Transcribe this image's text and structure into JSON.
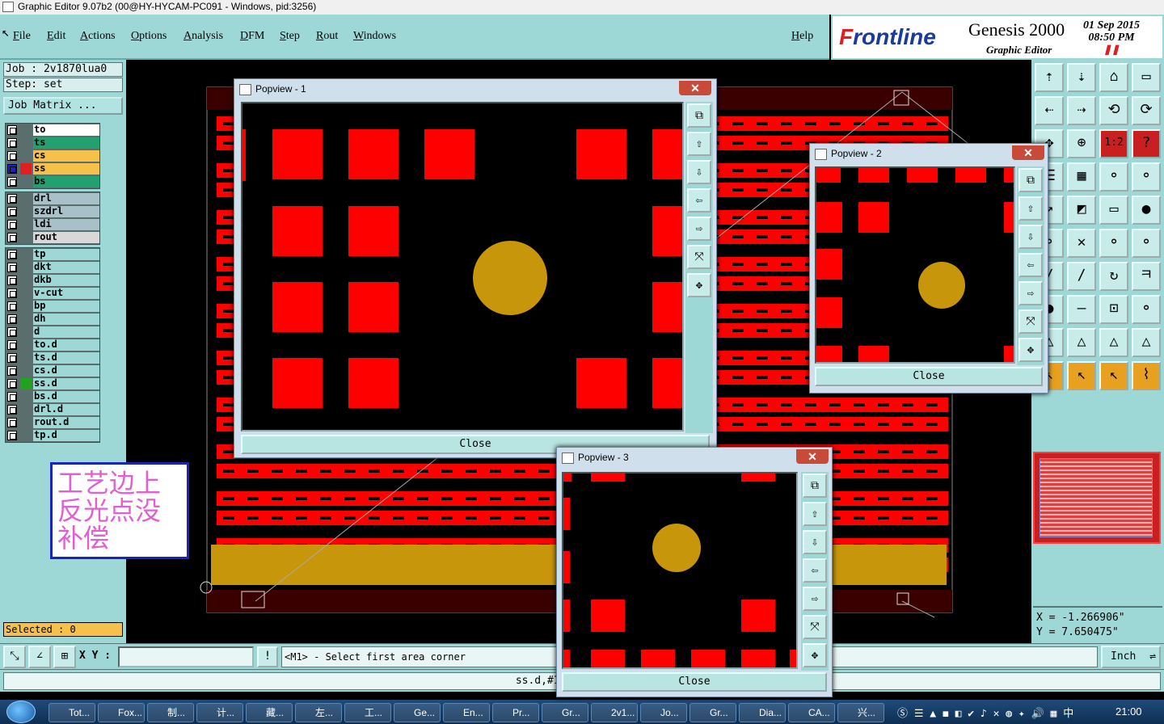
{
  "window": {
    "title": "Graphic Editor 9.07b2 (00@HY-HYCAM-PC091 - Windows, pid:3256)"
  },
  "menu": {
    "items": [
      "File",
      "Edit",
      "Actions",
      "Options",
      "Analysis",
      "DFM",
      "Step",
      "Rout",
      "Windows"
    ],
    "help": "Help"
  },
  "brand": {
    "logo_f": "F",
    "logo_rest": "rontline",
    "product": "Genesis 2000",
    "subtitle": "Graphic Editor",
    "date": "01 Sep 2015",
    "time": "08:50 PM"
  },
  "left": {
    "job": "Job : 2v1870lua0",
    "step": "Step: set",
    "job_matrix": "Job Matrix ...",
    "layers_board": [
      {
        "name": "to",
        "color": "#ffffff"
      },
      {
        "name": "ts",
        "color": "#22a070"
      },
      {
        "name": "cs",
        "color": "#f5c14a"
      },
      {
        "name": "ss",
        "color": "#f5c14a",
        "active": true
      },
      {
        "name": "bs",
        "color": "#22a070"
      }
    ],
    "layers_drill": [
      {
        "name": "drl",
        "color": "#a8c0c8"
      },
      {
        "name": "szdrl",
        "color": "#a8c0c8"
      },
      {
        "name": "ldi",
        "color": "#a8c0c8"
      },
      {
        "name": "rout",
        "color": "#d8d8d8"
      }
    ],
    "layers_misc": [
      {
        "name": "tp",
        "color": "#9ed8d6"
      },
      {
        "name": "dkt",
        "color": "#9ed8d6"
      },
      {
        "name": "dkb",
        "color": "#9ed8d6"
      },
      {
        "name": "v-cut",
        "color": "#9ed8d6"
      },
      {
        "name": "bp",
        "color": "#9ed8d6"
      },
      {
        "name": "dh",
        "color": "#9ed8d6"
      },
      {
        "name": "d",
        "color": "#9ed8d6"
      },
      {
        "name": "to.d",
        "color": "#9ed8d6"
      },
      {
        "name": "ts.d",
        "color": "#9ed8d6"
      },
      {
        "name": "cs.d",
        "color": "#9ed8d6"
      },
      {
        "name": "ss.d",
        "color": "#9ed8d6",
        "marked": true
      },
      {
        "name": "bs.d",
        "color": "#9ed8d6"
      },
      {
        "name": "drl.d",
        "color": "#9ed8d6"
      },
      {
        "name": "rout.d",
        "color": "#9ed8d6"
      },
      {
        "name": "tp.d",
        "color": "#9ed8d6"
      }
    ],
    "selected": "Selected : 0"
  },
  "note": {
    "line1": "工艺边上",
    "line2": "反光点没",
    "line3": "补偿"
  },
  "popups": {
    "p1": {
      "title": "Popview - 1",
      "close": "Close"
    },
    "p2": {
      "title": "Popview - 2",
      "close": "Close"
    },
    "p3": {
      "title": "Popview - 3",
      "close": "Close"
    }
  },
  "coords": {
    "x": "X = -1.266906\"",
    "y": "Y = 7.650475\""
  },
  "bottom": {
    "xy_label": "X Y :",
    "xy_value": "",
    "prompt": "<M1> - Select first area corner",
    "units": "Inch"
  },
  "status": {
    "text": "ss.d,#1604,Pad,X=0.78"
  },
  "taskbar": {
    "items": [
      "Tot...",
      "Fox...",
      "制...",
      "计...",
      "藏...",
      "左...",
      "工...",
      "Ge...",
      "En...",
      "Pr...",
      "Gr...",
      "2v1...",
      "Jo...",
      "Gr...",
      "Dia...",
      "CA...",
      "兴..."
    ],
    "clock": "21:00"
  },
  "colors": {
    "panel": "#9ed8d6",
    "copper": "#ff0000",
    "fiducial": "#c8960a"
  }
}
